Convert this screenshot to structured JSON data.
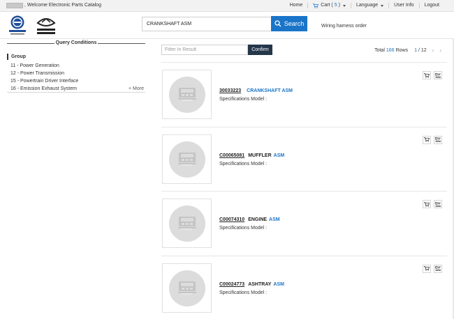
{
  "topbar": {
    "welcome": ", Welcome Electronic Parts Catalog",
    "nav": {
      "home": "Home",
      "cart_label": "Cart (",
      "cart_count": "5",
      "cart_close": ")",
      "language": "Language",
      "user_info": "User Info",
      "logout": "Logout"
    }
  },
  "header": {
    "logos": [
      "saic-logo",
      "maxus-logo"
    ],
    "search_value": "CRANKSHAFT ASM",
    "search_button": "Search",
    "wiring_link": "Wiring harness order"
  },
  "sidebar": {
    "title": "Query Conditions",
    "group_heading": "Group",
    "groups": [
      "11 - Power Generation",
      "12 - Power Transmission",
      "15 - Powertrain Driver Interface",
      "16 - Emission Exhaust System"
    ],
    "more": "+ More"
  },
  "filter": {
    "placeholder": "Filter In Result",
    "confirm": "Confirm"
  },
  "pagination": {
    "total_label": "Total",
    "total_count": "166",
    "rows_label": "Rows",
    "current_page": "1",
    "page_sep": "/",
    "total_pages": "12"
  },
  "results": [
    {
      "part_no": "30033223",
      "name_dark": "",
      "name_blue": "CRANKSHAFT ASM",
      "specs": "Specifications Model :"
    },
    {
      "part_no": "C00065081",
      "name_dark": "MUFFLER",
      "name_blue": "ASM",
      "specs": "Specifications Model :"
    },
    {
      "part_no": "C00074310",
      "name_dark": "ENGINE",
      "name_blue": "ASM",
      "specs": "Specifications Model :"
    },
    {
      "part_no": "C00024773",
      "name_dark": "ASHTRAY",
      "name_blue": "ASM",
      "specs": "Specifications Model :"
    }
  ],
  "colors": {
    "accent": "#1a75c9",
    "confirm_bg": "#24364a",
    "placeholder_circle": "#dcdcdc"
  }
}
